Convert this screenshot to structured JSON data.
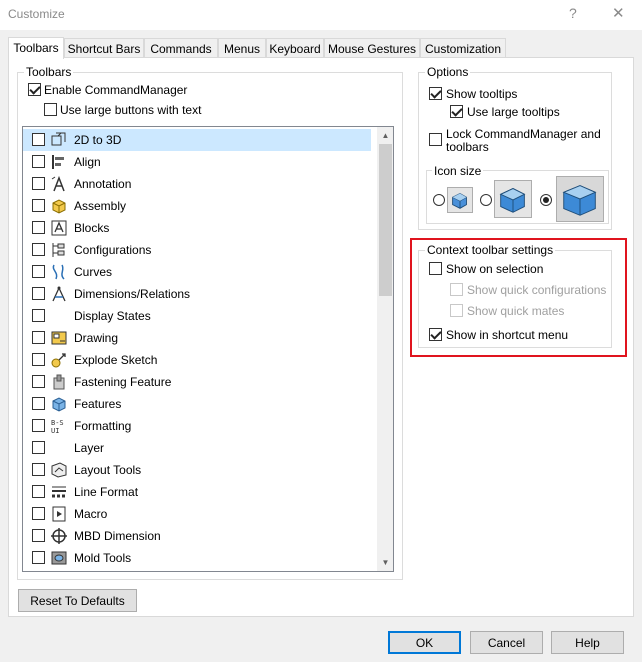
{
  "window": {
    "title": "Customize",
    "help_glyph": "?",
    "close_glyph": "✕"
  },
  "tabs": [
    {
      "label": "Toolbars",
      "active": true
    },
    {
      "label": "Shortcut Bars"
    },
    {
      "label": "Commands"
    },
    {
      "label": "Menus"
    },
    {
      "label": "Keyboard"
    },
    {
      "label": "Mouse Gestures"
    },
    {
      "label": "Customization"
    }
  ],
  "toolbars": {
    "group_label": "Toolbars",
    "enable_commandmanager": {
      "label": "Enable CommandManager",
      "checked": true
    },
    "use_large_buttons": {
      "label": "Use large buttons with text",
      "checked": false
    },
    "items": [
      {
        "label": "2D to 3D",
        "icon": "2d-to-3d-icon",
        "selected": true
      },
      {
        "label": "Align",
        "icon": "align-icon"
      },
      {
        "label": "Annotation",
        "icon": "annotation-icon"
      },
      {
        "label": "Assembly",
        "icon": "assembly-icon"
      },
      {
        "label": "Blocks",
        "icon": "blocks-icon"
      },
      {
        "label": "Configurations",
        "icon": "configurations-icon"
      },
      {
        "label": "Curves",
        "icon": "curves-icon"
      },
      {
        "label": "Dimensions/Relations",
        "icon": "dimensions-relations-icon"
      },
      {
        "label": "Display States",
        "icon": ""
      },
      {
        "label": "Drawing",
        "icon": "drawing-icon"
      },
      {
        "label": "Explode Sketch",
        "icon": "explode-sketch-icon"
      },
      {
        "label": "Fastening Feature",
        "icon": "fastening-feature-icon"
      },
      {
        "label": "Features",
        "icon": "features-icon"
      },
      {
        "label": "Formatting",
        "icon": "formatting-icon"
      },
      {
        "label": "Layer",
        "icon": ""
      },
      {
        "label": "Layout Tools",
        "icon": "layout-tools-icon"
      },
      {
        "label": "Line Format",
        "icon": "line-format-icon"
      },
      {
        "label": "Macro",
        "icon": "macro-icon"
      },
      {
        "label": "MBD Dimension",
        "icon": "mbd-dimension-icon"
      },
      {
        "label": "Mold Tools",
        "icon": "mold-tools-icon"
      }
    ],
    "reset_label": "Reset To Defaults",
    "scroll_up_glyph": "▲",
    "scroll_down_glyph": "▼"
  },
  "options": {
    "group_label": "Options",
    "show_tooltips": {
      "label": "Show tooltips",
      "checked": true
    },
    "use_large_tooltips": {
      "label": "Use large tooltips",
      "checked": true
    },
    "lock_commandmanager_line1": "Lock CommandManager and",
    "lock_commandmanager_line2": "toolbars",
    "lock_commandmanager_checked": false,
    "icon_size": {
      "label": "Icon size",
      "selected": "large"
    }
  },
  "context_toolbar": {
    "group_label": "Context toolbar settings",
    "show_on_selection": {
      "label": "Show on selection",
      "checked": false
    },
    "show_quick_configurations": {
      "label": "Show quick configurations",
      "checked": false,
      "disabled": true
    },
    "show_quick_mates": {
      "label": "Show quick mates",
      "checked": false,
      "disabled": true
    },
    "show_in_shortcut_menu": {
      "label": "Show in shortcut menu",
      "checked": true
    }
  },
  "footer": {
    "ok_label": "OK",
    "cancel_label": "Cancel",
    "help_label": "Help"
  },
  "colors": {
    "highlight": "#e0141e",
    "selection": "#cce8ff",
    "default_button_border": "#0078d7"
  }
}
